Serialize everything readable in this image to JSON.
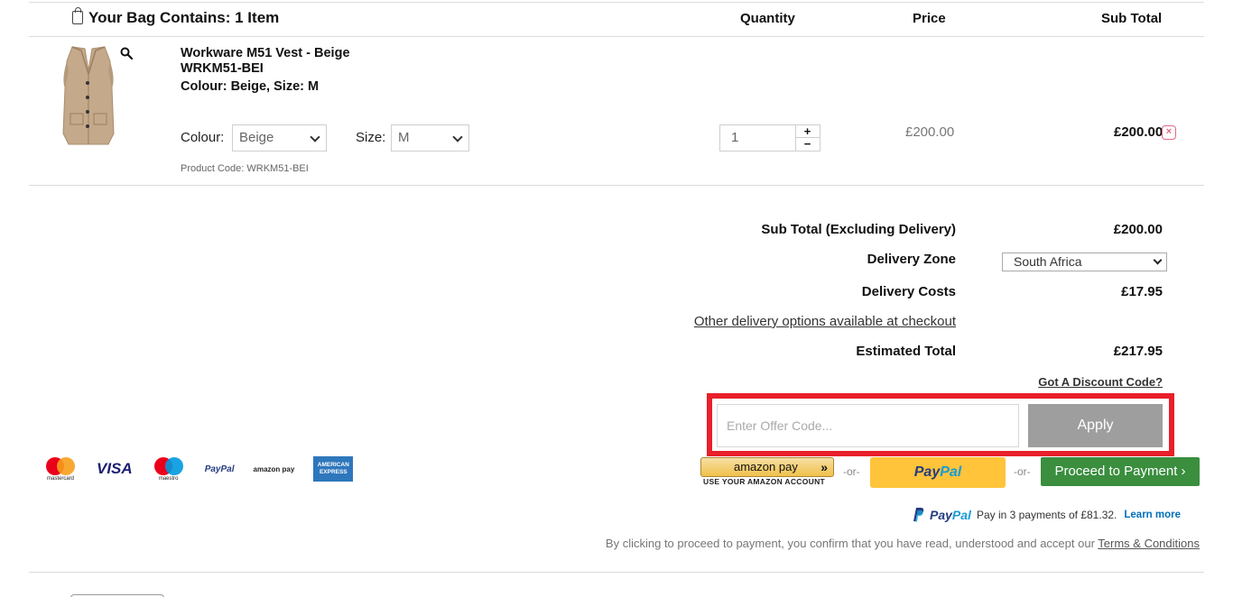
{
  "cart": {
    "title": "Your Bag Contains: 1 Item",
    "columns": {
      "quantity": "Quantity",
      "price": "Price",
      "subtotal": "Sub Total"
    }
  },
  "item": {
    "name": "Workware M51 Vest - Beige",
    "sku": "WRKM51-BEI",
    "variant": "Colour: Beige, Size: M",
    "colour_label": "Colour:",
    "colour_value": "Beige",
    "size_label": "Size:",
    "size_value": "M",
    "product_code": "Product Code: WRKM51-BEI",
    "quantity": "1",
    "qty_plus": "+",
    "qty_minus": "−",
    "price": "£200.00",
    "subtotal": "£200.00",
    "remove_glyph": "×"
  },
  "summary": {
    "subtotal_label": "Sub Total (Excluding Delivery)",
    "subtotal_value": "£200.00",
    "zone_label": "Delivery Zone",
    "zone_value": "South Africa",
    "delivery_label": "Delivery Costs",
    "delivery_value": "£17.95",
    "other_delivery": "Other delivery options available at checkout",
    "estimated_label": "Estimated Total",
    "estimated_value": "£217.95"
  },
  "discount": {
    "link": "Got A Discount Code?",
    "placeholder": "Enter Offer Code...",
    "apply": "Apply"
  },
  "payment_logos": {
    "mastercard": "mastercard",
    "visa": "VISA",
    "maestro": "maestro",
    "paypal": "PayPal",
    "amazonpay": "amazon pay",
    "amex": "AMERICAN EXPRESS"
  },
  "checkout": {
    "amazon_label": "amazon pay",
    "amazon_sub": "USE YOUR AMAZON ACCOUNT",
    "or": "-or-",
    "paypal_pay": "Pay",
    "paypal_pal": "Pal",
    "proceed": "Proceed to Payment ›"
  },
  "paypal_credit": {
    "brand_pay": "Pay",
    "brand_pal": "Pal",
    "text": "Pay in 3 payments of £81.32.",
    "learn_more": "Learn more"
  },
  "terms": {
    "text": "By clicking to proceed to payment, you confirm that you have read, understood and accept our ",
    "link": "Terms & Conditions"
  },
  "colors": {
    "highlight": "#e8202a",
    "proceed": "#3a8e3e",
    "paypal_yellow": "#ffc439",
    "apply_grey": "#9e9e9e"
  }
}
